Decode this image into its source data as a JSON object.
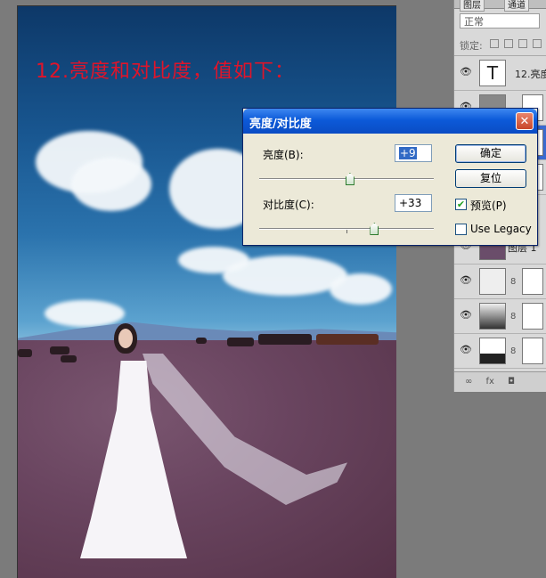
{
  "canvas": {
    "caption": "12.亮度和对比度，值如下："
  },
  "layers_panel": {
    "tabs": [
      "图层",
      "通道"
    ],
    "blend_mode": "正常",
    "lock_label": "锁定:",
    "layers": [
      {
        "name": "12.亮度",
        "thumb": "T"
      },
      {
        "name": ""
      },
      {
        "name": ""
      },
      {
        "name": ""
      },
      {
        "name": "图层 1"
      },
      {
        "name": ""
      },
      {
        "name": ""
      },
      {
        "name": ""
      }
    ],
    "footer_icons": [
      "link-icon",
      "fx-icon",
      "mask-icon"
    ]
  },
  "dialog": {
    "title": "亮度/对比度",
    "close_glyph": "✕",
    "brightness_label": "亮度(B):",
    "brightness_value": "+9",
    "brightness_slider_fraction": 0.52,
    "contrast_label": "对比度(C):",
    "contrast_value": "+33",
    "contrast_slider_fraction": 0.66,
    "ok_label": "确定",
    "reset_label": "复位",
    "preview_label": "预览(P)",
    "preview_checked": true,
    "legacy_label": "Use Legacy",
    "legacy_checked": false
  }
}
